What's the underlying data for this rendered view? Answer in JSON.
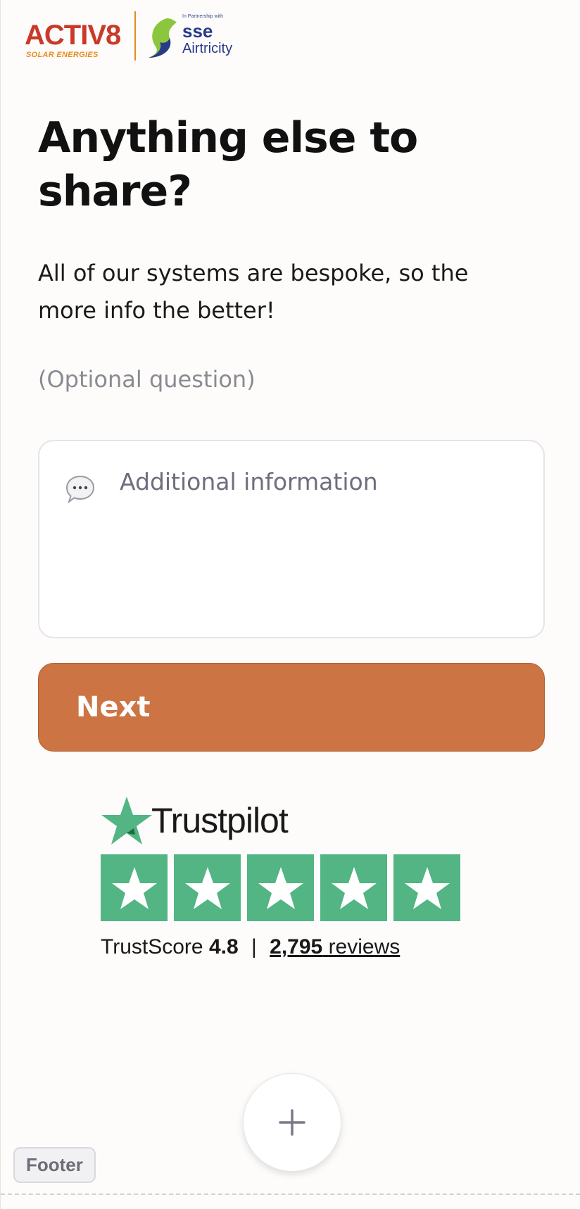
{
  "header": {
    "brand_name": "ACTIV8",
    "brand_tagline": "SOLAR ENERGIES",
    "partner_prefix": "In Partnership with",
    "partner_name": "sse",
    "partner_sub": "Airtricity"
  },
  "question": {
    "title": "Anything else to share?",
    "subtitle": "All of our systems are bespoke, so the more info the better!",
    "optional_note": "(Optional question)"
  },
  "input": {
    "icon": "speech-bubble-icon",
    "placeholder": "Additional information",
    "value": ""
  },
  "actions": {
    "next_label": "Next"
  },
  "trustpilot": {
    "logo_text": "Trustpilot",
    "score_label": "TrustScore",
    "score_value": "4.8",
    "separator": "|",
    "reviews_count": "2,795",
    "reviews_label": "reviews",
    "star_count": 5,
    "star_color": "#52b583"
  },
  "editor": {
    "add_icon": "plus-icon",
    "footer_label": "Footer"
  },
  "colors": {
    "accent_button": "#cc7443",
    "brand_red": "#c93a2a",
    "brand_orange": "#e88b1f",
    "partner_blue": "#2a3a8a"
  }
}
